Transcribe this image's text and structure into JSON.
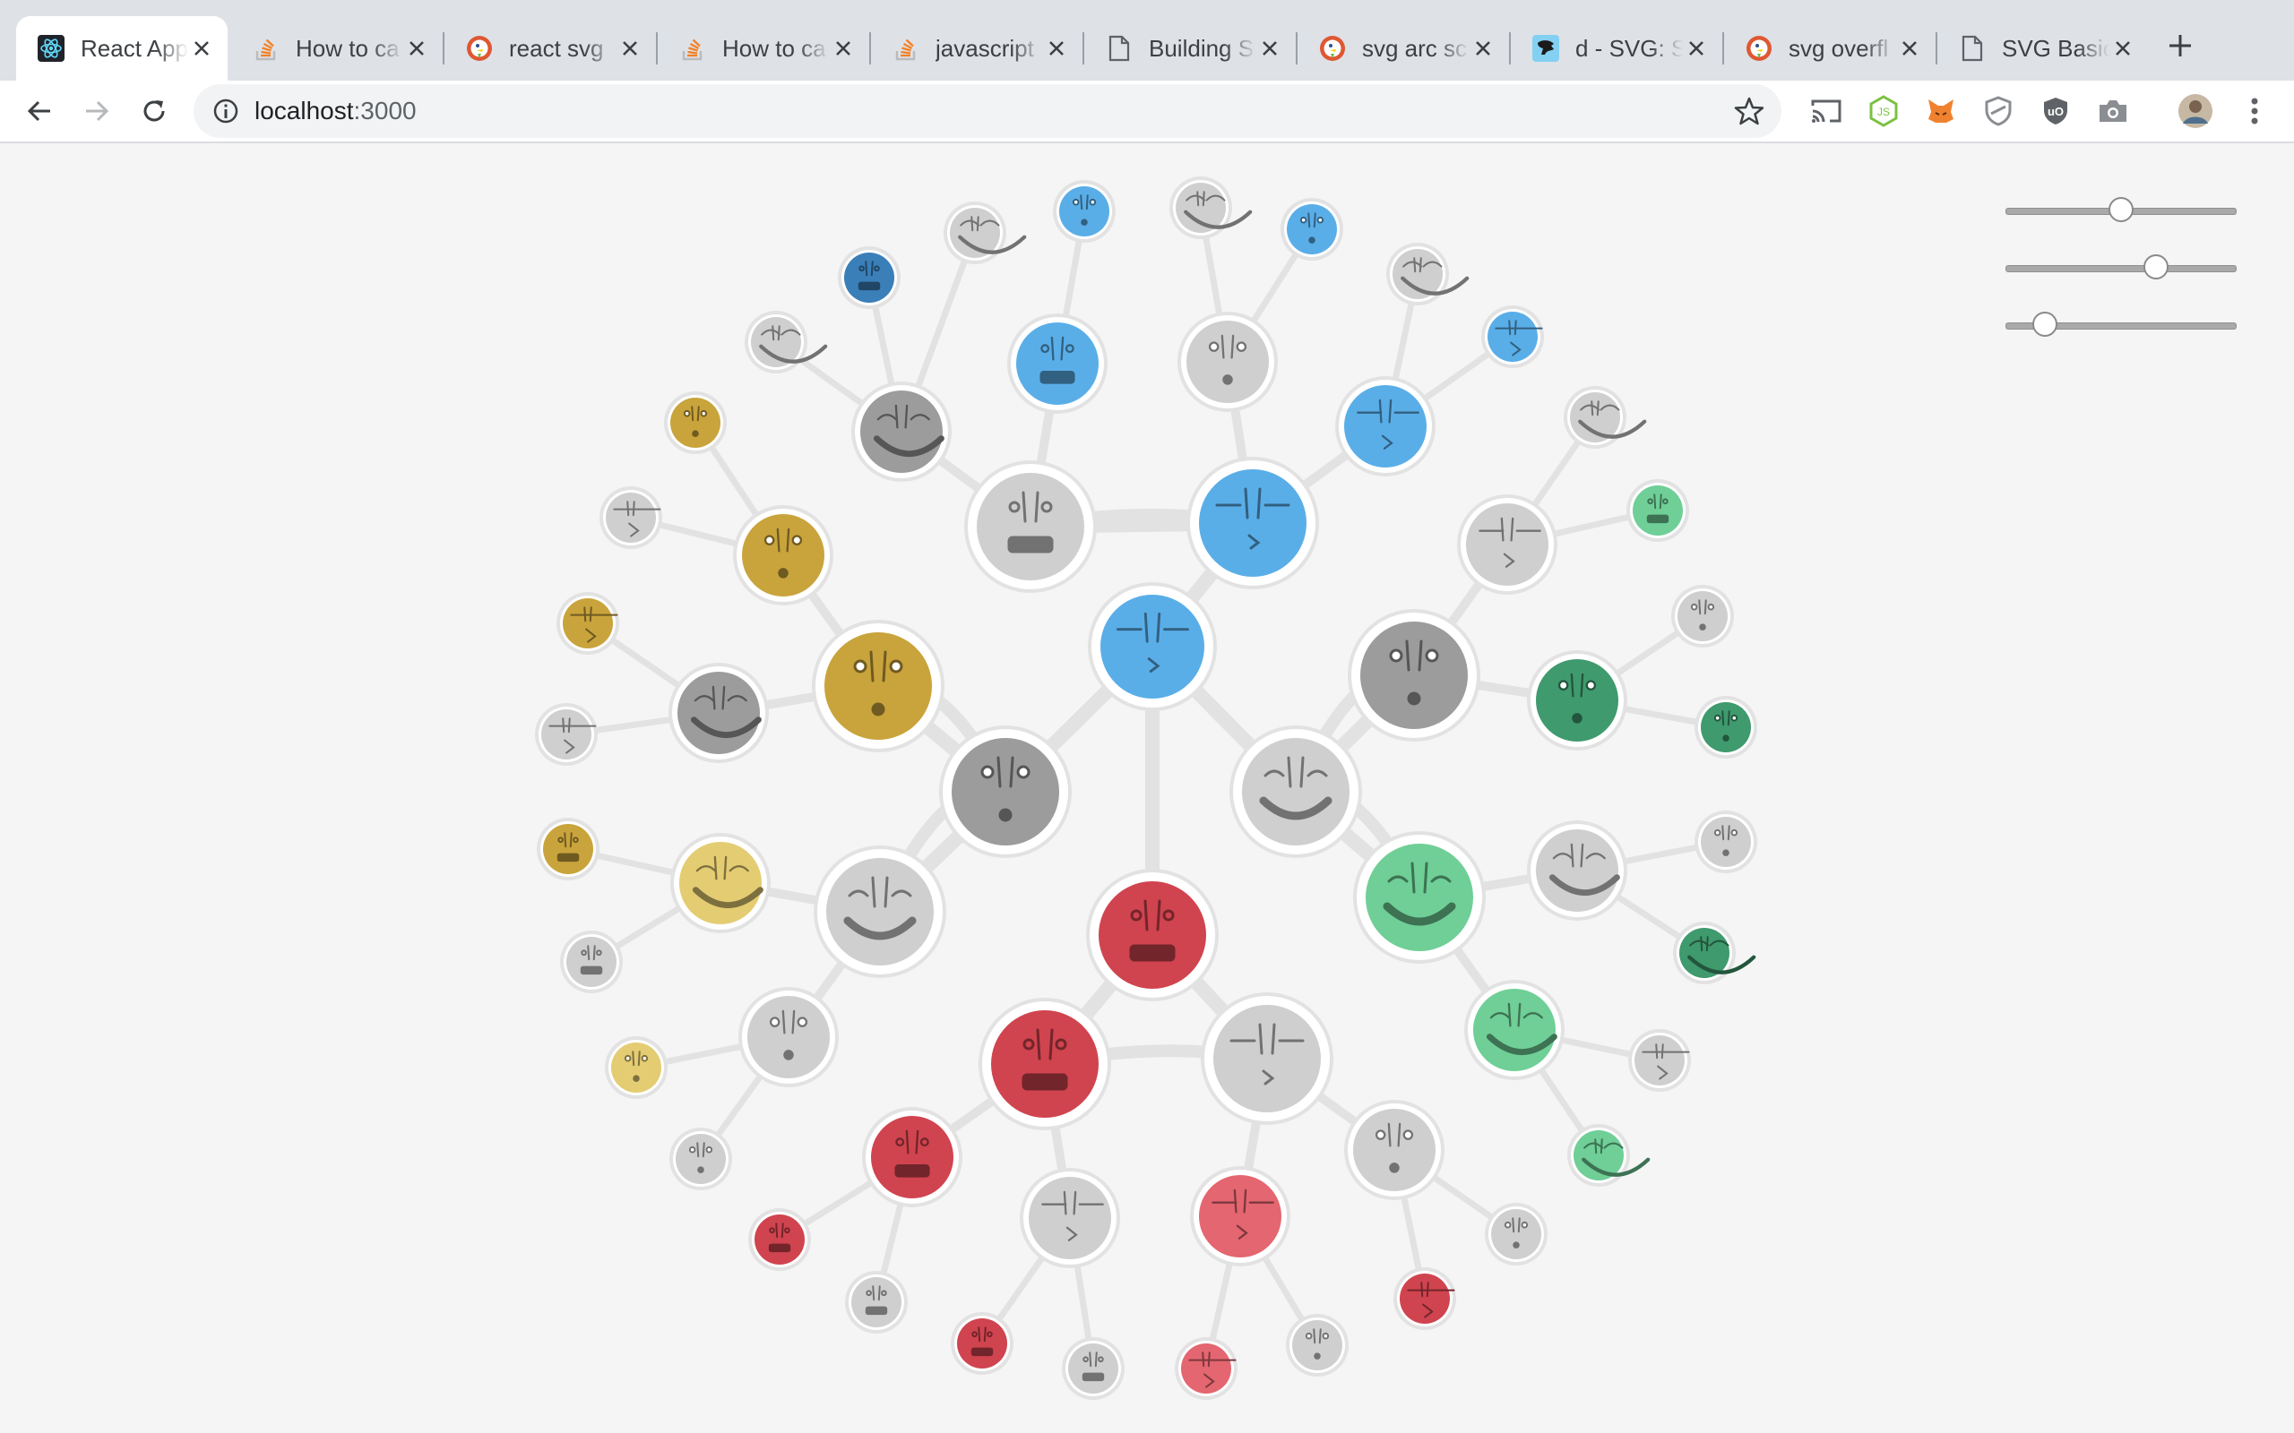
{
  "browser": {
    "tabs": [
      {
        "title": "React App",
        "icon": "react-icon",
        "active": true
      },
      {
        "title": "How to ca",
        "icon": "stackoverflow-icon"
      },
      {
        "title": "react svg",
        "icon": "duckduckgo-icon"
      },
      {
        "title": "How to ca",
        "icon": "stackoverflow-icon"
      },
      {
        "title": "javascript",
        "icon": "stackoverflow-icon"
      },
      {
        "title": "Building S",
        "icon": "document-icon"
      },
      {
        "title": "svg arc sc",
        "icon": "duckduckgo-icon"
      },
      {
        "title": "d - SVG: S",
        "icon": "mdn-icon"
      },
      {
        "title": "svg overfl",
        "icon": "duckduckgo-icon"
      },
      {
        "title": "SVG Basic",
        "icon": "document-icon"
      }
    ],
    "address": {
      "host": "localhost",
      "port": ":3000"
    }
  },
  "controls": {
    "sliders": [
      {
        "name": "slider-1",
        "value": 0.5
      },
      {
        "name": "slider-2",
        "value": 0.65
      },
      {
        "name": "slider-3",
        "value": 0.17
      }
    ]
  },
  "colors": {
    "gray": "#9c9c9c",
    "gray_light": "#cfcfcf",
    "blue": "#5aaee8",
    "blue_dark": "#3a7fb8",
    "gold": "#c9a43c",
    "gold_light": "#e4cc72",
    "green": "#3f9a6e",
    "green_light": "#6fcf97",
    "red": "#d0444f",
    "red_light": "#e46670",
    "link": "#e2e2e2",
    "ring": "#e2e2e2"
  }
}
